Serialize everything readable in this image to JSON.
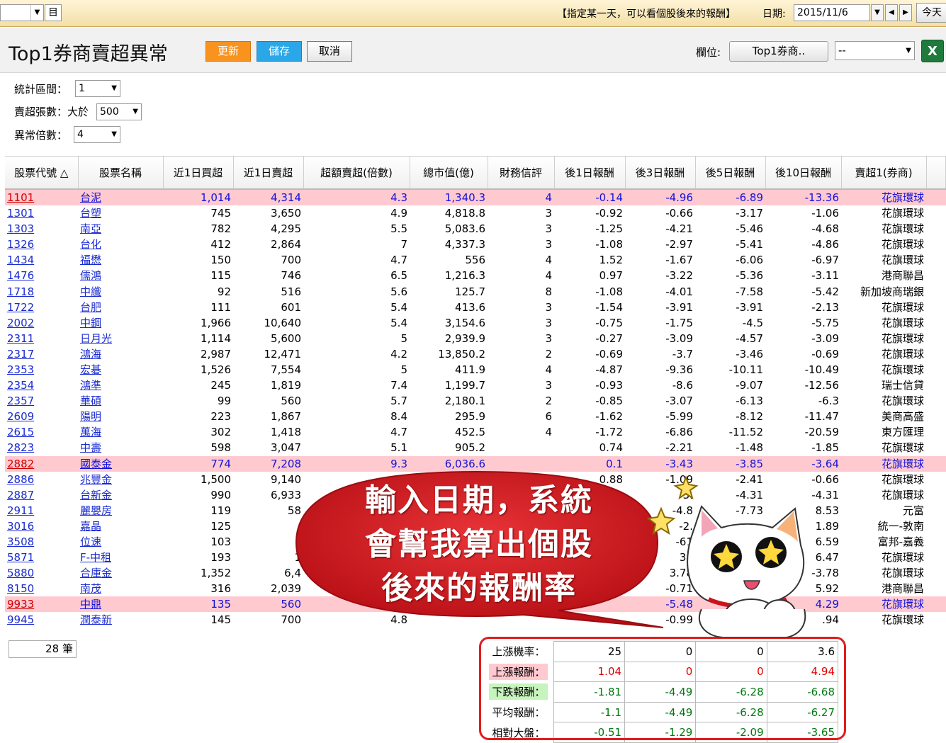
{
  "topbar": {
    "combo_value": "",
    "book_icon_label": "目",
    "hint": "【指定某一天，可以看個股後來的報酬】",
    "date_label": "日期:",
    "date_value": "2015/11/6",
    "today_label": "今天"
  },
  "header": {
    "title": "Top1券商賣超異常",
    "update_label": "更新",
    "save_label": "儲存",
    "cancel_label": "取消",
    "field_label": "欄位:",
    "field_button": "Top1券商..",
    "field_select": "--",
    "excel_icon_label": "X"
  },
  "filters": {
    "period_label": "統計區間：",
    "period_value": "1",
    "sell_label": "賣超張數：大於",
    "sell_value": "500",
    "ratio_label": "異常倍數：",
    "ratio_value": "4"
  },
  "table": {
    "columns": [
      "股票代號 △",
      "股票名稱",
      "近1日買超",
      "近1日賣超",
      "超額賣超(倍數)",
      "總市值(億)",
      "財務信評",
      "後1日報酬",
      "後3日報酬",
      "後5日報酬",
      "後10日報酬",
      "賣超1(券商)"
    ],
    "rows": [
      {
        "code": "1101",
        "name": "台泥",
        "buy": "1,014",
        "sell": "4,314",
        "ratio": "4.3",
        "cap": "1,340.3",
        "rating": "4",
        "r1": "-0.14",
        "r3": "-4.96",
        "r5": "-6.89",
        "r10": "-13.36",
        "broker": "花旗環球",
        "hl": true
      },
      {
        "code": "1301",
        "name": "台塑",
        "buy": "745",
        "sell": "3,650",
        "ratio": "4.9",
        "cap": "4,818.8",
        "rating": "3",
        "r1": "-0.92",
        "r3": "-0.66",
        "r5": "-3.17",
        "r10": "-1.06",
        "broker": "花旗環球",
        "hl": false
      },
      {
        "code": "1303",
        "name": "南亞",
        "buy": "782",
        "sell": "4,295",
        "ratio": "5.5",
        "cap": "5,083.6",
        "rating": "3",
        "r1": "-1.25",
        "r3": "-4.21",
        "r5": "-5.46",
        "r10": "-4.68",
        "broker": "花旗環球",
        "hl": false
      },
      {
        "code": "1326",
        "name": "台化",
        "buy": "412",
        "sell": "2,864",
        "ratio": "7",
        "cap": "4,337.3",
        "rating": "3",
        "r1": "-1.08",
        "r3": "-2.97",
        "r5": "-5.41",
        "r10": "-4.86",
        "broker": "花旗環球",
        "hl": false
      },
      {
        "code": "1434",
        "name": "福懋",
        "buy": "150",
        "sell": "700",
        "ratio": "4.7",
        "cap": "556",
        "rating": "4",
        "r1": "1.52",
        "r3": "-1.67",
        "r5": "-6.06",
        "r10": "-6.97",
        "broker": "花旗環球",
        "hl": false
      },
      {
        "code": "1476",
        "name": "儒鴻",
        "buy": "115",
        "sell": "746",
        "ratio": "6.5",
        "cap": "1,216.3",
        "rating": "4",
        "r1": "0.97",
        "r3": "-3.22",
        "r5": "-5.36",
        "r10": "-3.11",
        "broker": "港商聯昌",
        "hl": false
      },
      {
        "code": "1718",
        "name": "中纖",
        "buy": "92",
        "sell": "516",
        "ratio": "5.6",
        "cap": "125.7",
        "rating": "8",
        "r1": "-1.08",
        "r3": "-4.01",
        "r5": "-7.58",
        "r10": "-5.42",
        "broker": "新加坡商瑞銀",
        "hl": false
      },
      {
        "code": "1722",
        "name": "台肥",
        "buy": "111",
        "sell": "601",
        "ratio": "5.4",
        "cap": "413.6",
        "rating": "3",
        "r1": "-1.54",
        "r3": "-3.91",
        "r5": "-3.91",
        "r10": "-2.13",
        "broker": "花旗環球",
        "hl": false
      },
      {
        "code": "2002",
        "name": "中鋼",
        "buy": "1,966",
        "sell": "10,640",
        "ratio": "5.4",
        "cap": "3,154.6",
        "rating": "3",
        "r1": "-0.75",
        "r3": "-1.75",
        "r5": "-4.5",
        "r10": "-5.75",
        "broker": "花旗環球",
        "hl": false
      },
      {
        "code": "2311",
        "name": "日月光",
        "buy": "1,114",
        "sell": "5,600",
        "ratio": "5",
        "cap": "2,939.9",
        "rating": "3",
        "r1": "-0.27",
        "r3": "-3.09",
        "r5": "-4.57",
        "r10": "-3.09",
        "broker": "花旗環球",
        "hl": false
      },
      {
        "code": "2317",
        "name": "鴻海",
        "buy": "2,987",
        "sell": "12,471",
        "ratio": "4.2",
        "cap": "13,850.2",
        "rating": "2",
        "r1": "-0.69",
        "r3": "-3.7",
        "r5": "-3.46",
        "r10": "-0.69",
        "broker": "花旗環球",
        "hl": false
      },
      {
        "code": "2353",
        "name": "宏碁",
        "buy": "1,526",
        "sell": "7,554",
        "ratio": "5",
        "cap": "411.9",
        "rating": "4",
        "r1": "-4.87",
        "r3": "-9.36",
        "r5": "-10.11",
        "r10": "-10.49",
        "broker": "花旗環球",
        "hl": false
      },
      {
        "code": "2354",
        "name": "鴻準",
        "buy": "245",
        "sell": "1,819",
        "ratio": "7.4",
        "cap": "1,199.7",
        "rating": "3",
        "r1": "-0.93",
        "r3": "-8.6",
        "r5": "-9.07",
        "r10": "-12.56",
        "broker": "瑞士信貸",
        "hl": false
      },
      {
        "code": "2357",
        "name": "華碩",
        "buy": "99",
        "sell": "560",
        "ratio": "5.7",
        "cap": "2,180.1",
        "rating": "2",
        "r1": "-0.85",
        "r3": "-3.07",
        "r5": "-6.13",
        "r10": "-6.3",
        "broker": "花旗環球",
        "hl": false
      },
      {
        "code": "2609",
        "name": "陽明",
        "buy": "223",
        "sell": "1,867",
        "ratio": "8.4",
        "cap": "295.9",
        "rating": "6",
        "r1": "-1.62",
        "r3": "-5.99",
        "r5": "-8.12",
        "r10": "-11.47",
        "broker": "美商高盛",
        "hl": false
      },
      {
        "code": "2615",
        "name": "萬海",
        "buy": "302",
        "sell": "1,418",
        "ratio": "4.7",
        "cap": "452.5",
        "rating": "4",
        "r1": "-1.72",
        "r3": "-6.86",
        "r5": "-11.52",
        "r10": "-20.59",
        "broker": "東方匯理",
        "hl": false
      },
      {
        "code": "2823",
        "name": "中壽",
        "buy": "598",
        "sell": "3,047",
        "ratio": "5.1",
        "cap": "905.2",
        "rating": "",
        "r1": "0.74",
        "r3": "-2.21",
        "r5": "-1.48",
        "r10": "-1.85",
        "broker": "花旗環球",
        "hl": false
      },
      {
        "code": "2882",
        "name": "國泰金",
        "buy": "774",
        "sell": "7,208",
        "ratio": "9.3",
        "cap": "6,036.6",
        "rating": "",
        "r1": "0.1",
        "r3": "-3.43",
        "r5": "-3.85",
        "r10": "-3.64",
        "broker": "花旗環球",
        "hl": true
      },
      {
        "code": "2886",
        "name": "兆豐金",
        "buy": "1,500",
        "sell": "9,140",
        "ratio": "",
        "cap": "",
        "rating": "",
        "r1": "0.88",
        "r3": "-1.09",
        "r5": "-2.41",
        "r10": "-0.66",
        "broker": "花旗環球",
        "hl": false
      },
      {
        "code": "2887",
        "name": "台新金",
        "buy": "990",
        "sell": "6,933",
        "ratio": "",
        "cap": "",
        "rating": "",
        "r1": "",
        "r3": "-3.",
        "r5": "-4.31",
        "r10": "-4.31",
        "broker": "花旗環球",
        "hl": false
      },
      {
        "code": "2911",
        "name": "麗嬰房",
        "buy": "119",
        "sell": "58",
        "ratio": "",
        "cap": "",
        "rating": "",
        "r1": "",
        "r3": "-4.8",
        "r5": "-7.73",
        "r10": "8.53",
        "broker": "元富",
        "hl": false
      },
      {
        "code": "3016",
        "name": "嘉晶",
        "buy": "125",
        "sell": "",
        "ratio": "",
        "cap": "",
        "rating": "",
        "r1": "",
        "r3": "-2.",
        "r5": "",
        "r10": "1.89",
        "broker": "統一-敦南",
        "hl": false
      },
      {
        "code": "3508",
        "name": "位速",
        "buy": "103",
        "sell": "",
        "ratio": "",
        "cap": "",
        "rating": "",
        "r1": "",
        "r3": "-61",
        "r5": "",
        "r10": "6.59",
        "broker": "富邦-嘉義",
        "hl": false
      },
      {
        "code": "5871",
        "name": "F-中租",
        "buy": "193",
        "sell": "1",
        "ratio": "",
        "cap": "",
        "rating": "",
        "r1": "",
        "r3": "34",
        "r5": "",
        "r10": "6.47",
        "broker": "花旗環球",
        "hl": false
      },
      {
        "code": "5880",
        "name": "合庫金",
        "buy": "1,352",
        "sell": "6,4",
        "ratio": "",
        "cap": "",
        "rating": "",
        "r1": "",
        "r3": "3.78",
        "r5": "",
        "r10": "-3.78",
        "broker": "花旗環球",
        "hl": false
      },
      {
        "code": "8150",
        "name": "南茂",
        "buy": "316",
        "sell": "2,039",
        "ratio": "",
        "cap": "",
        "rating": "",
        "r1": "",
        "r3": "-0.71",
        "r5": "",
        "r10": "5.92",
        "broker": "港商聯昌",
        "hl": false
      },
      {
        "code": "9933",
        "name": "中鼎",
        "buy": "135",
        "sell": "560",
        "ratio": "",
        "cap": "",
        "rating": "",
        "r1": "",
        "r3": "-5.48",
        "r5": "",
        "r10": "4.29",
        "broker": "花旗環球",
        "hl": true
      },
      {
        "code": "9945",
        "name": "潤泰新",
        "buy": "145",
        "sell": "700",
        "ratio": "4.8",
        "cap": "",
        "rating": "",
        "r1": "",
        "r3": "-0.99",
        "r5": "",
        "r10": ".94",
        "broker": "花旗環球",
        "hl": false
      }
    ]
  },
  "count_text": "28 筆",
  "summary": [
    {
      "label": "上漲機率：",
      "style": "plain",
      "values": [
        "25",
        "0",
        "0",
        "3.6"
      ],
      "color": "black"
    },
    {
      "label": "上漲報酬：",
      "style": "pink",
      "values": [
        "1.04",
        "0",
        "0",
        "4.94"
      ],
      "color": "red"
    },
    {
      "label": "下跌報酬：",
      "style": "green",
      "values": [
        "-1.81",
        "-4.49",
        "-6.28",
        "-6.68"
      ],
      "color": "green"
    },
    {
      "label": "平均報酬：",
      "style": "plain",
      "values": [
        "-1.1",
        "-4.49",
        "-6.28",
        "-6.27"
      ],
      "color": "green"
    },
    {
      "label": "相對大盤：",
      "style": "plain",
      "values": [
        "-0.51",
        "-1.29",
        "-2.09",
        "-3.65"
      ],
      "color": "green"
    }
  ],
  "callout": {
    "line1": "輸入日期，系統",
    "line2": "會幫我算出個股",
    "line3": "後來的報酬率"
  },
  "colors": {
    "highlight_row": "#ffc9d0",
    "link_blue": "#1a2bd1",
    "callout_red": "#c8151b",
    "update_orange": "#f7931e",
    "save_blue": "#2aa7e8"
  }
}
